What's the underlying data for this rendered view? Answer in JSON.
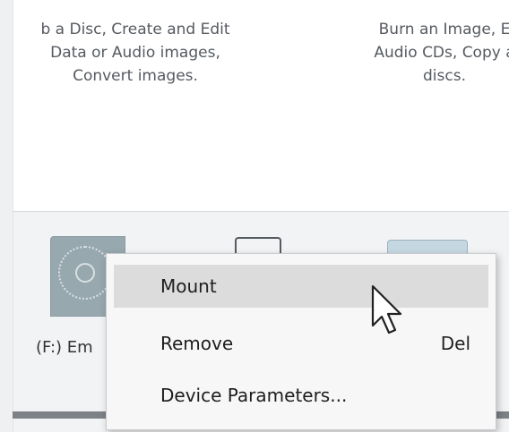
{
  "descriptions": [
    {
      "lines": [
        "b a Disc, Create and Edit",
        "Data or Audio images,",
        "Convert images."
      ]
    },
    {
      "lines": [
        "Burn an Image, E",
        "Audio CDs, Copy a",
        "discs."
      ]
    }
  ],
  "devices": [
    {
      "label": "(F:) Em",
      "icon": "disc-drive-icon"
    },
    {
      "label": "",
      "icon": "device-icon"
    },
    {
      "label": "",
      "icon": "drive-icon"
    }
  ],
  "context_menu": {
    "items": [
      {
        "label": "Mount",
        "shortcut": "",
        "highlighted": true
      },
      {
        "label": "Remove",
        "shortcut": "Del",
        "highlighted": false
      },
      {
        "label": "Device Parameters...",
        "shortcut": "",
        "highlighted": false
      }
    ]
  },
  "colors": {
    "menu_highlight": "#dcdcdc",
    "drive_icon": "#97a8af",
    "background": "#eef0f2"
  },
  "cursor": "arrow-cursor-icon"
}
